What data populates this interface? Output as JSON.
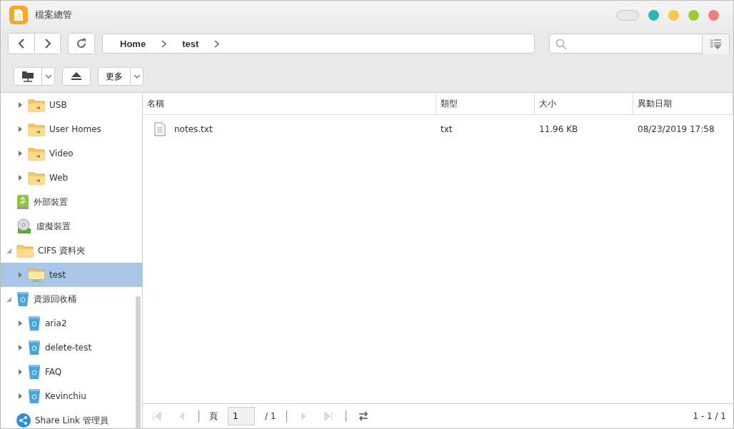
{
  "window": {
    "title": "檔案總管"
  },
  "breadcrumb": [
    "Home",
    "test"
  ],
  "toolbar": {
    "more_label": "更多"
  },
  "sidebar": {
    "tree": [
      {
        "children": [
          {
            "label": "USB",
            "kind": "share",
            "expanded": false
          },
          {
            "label": "User Homes",
            "kind": "share",
            "expanded": false
          },
          {
            "label": "Video",
            "kind": "share",
            "expanded": false
          },
          {
            "label": "Web",
            "kind": "share",
            "expanded": false
          }
        ]
      },
      {
        "label": "外部裝置",
        "kind": "usb"
      },
      {
        "label": "虛擬裝置",
        "kind": "disc"
      },
      {
        "label": "CIFS 資料夾",
        "kind": "folder",
        "expanded": true,
        "children": [
          {
            "label": "test",
            "kind": "network-folder",
            "expanded": false,
            "selected": true
          }
        ]
      },
      {
        "label": "資源回收桶",
        "kind": "recycle",
        "expanded": true,
        "children": [
          {
            "label": "aria2",
            "kind": "recycle",
            "expanded": false,
            "selected": false
          },
          {
            "label": "delete-test",
            "kind": "recycle",
            "expanded": false,
            "selected": false
          },
          {
            "label": "FAQ",
            "kind": "recycle",
            "expanded": false,
            "selected": false
          },
          {
            "label": "Kevinchiu",
            "kind": "recycle",
            "expanded": false,
            "selected": false
          }
        ]
      },
      {
        "label": "Share Link 管理員",
        "kind": "sharelink"
      }
    ]
  },
  "table": {
    "columns": [
      "名稱",
      "類型",
      "大小",
      "異動日期"
    ],
    "rows": [
      {
        "cells": [
          "notes.txt",
          "txt",
          "11.96 KB",
          "08/23/2019 17:58"
        ]
      }
    ]
  },
  "pager": {
    "page_label": "頁",
    "page": "1",
    "total": "/ 1",
    "range": "1 - 1 / 1"
  }
}
